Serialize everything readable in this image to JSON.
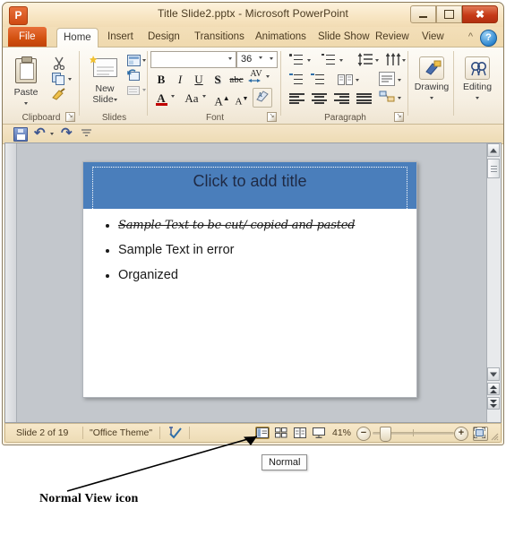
{
  "window": {
    "title": "Title Slide2.pptx  -  Microsoft PowerPoint",
    "app_logo": "P",
    "minimize_label": "Minimize",
    "maximize_label": "Restore",
    "close_label": "Close"
  },
  "tabs": [
    {
      "label": "File",
      "active": false,
      "type": "file"
    },
    {
      "label": "Home",
      "active": true
    },
    {
      "label": "Insert",
      "active": false
    },
    {
      "label": "Design",
      "active": false
    },
    {
      "label": "Transitions",
      "active": false
    },
    {
      "label": "Animations",
      "active": false
    },
    {
      "label": "Slide Show",
      "active": false
    },
    {
      "label": "Review",
      "active": false
    },
    {
      "label": "View",
      "active": false
    }
  ],
  "ribbon": {
    "collapse_label": "^",
    "help_label": "?",
    "groups": [
      {
        "name": "Clipboard",
        "label": "Clipboard"
      },
      {
        "name": "Slides",
        "label": "Slides"
      },
      {
        "name": "Font",
        "label": "Font"
      },
      {
        "name": "Paragraph",
        "label": "Paragraph"
      },
      {
        "name": "Drawing",
        "label": "Drawing"
      },
      {
        "name": "Editing",
        "label": "Editing"
      }
    ],
    "clipboard": {
      "paste_label": "Paste",
      "cut_label": "Cut",
      "copy_label": "Copy",
      "format_painter_label": "Format Painter",
      "dialog_launcher": "↘"
    },
    "slides": {
      "new_slide_line1": "New",
      "new_slide_line2": "Slide",
      "layout_label": "Layout",
      "reset_label": "Reset",
      "section_label": "Section"
    },
    "font": {
      "font_name_value": "",
      "font_size_value": "36",
      "bold_label": "B",
      "italic_label": "I",
      "underline_label": "U",
      "shadow_label": "S",
      "strikethrough_label": "abc",
      "character_spacing_label": "AV",
      "font_color_label": "A",
      "change_case_label": "Aa",
      "grow_font_label": "A",
      "shrink_font_label": "A",
      "clear_formatting_label": "A",
      "dialog_launcher": "↘"
    },
    "paragraph": {
      "bullets_label": "Bullets",
      "numbering_label": "Numbering",
      "line_spacing_label": "Line Spacing",
      "text_direction_label": "Text Direction",
      "decrease_indent_label": "Decrease Indent",
      "increase_indent_label": "Increase Indent",
      "columns_label": "Columns",
      "align_text_label": "Align Text",
      "smartart_label": "Convert to SmartArt",
      "align_left_label": "Align Left",
      "center_label": "Center",
      "align_right_label": "Align Right",
      "justify_label": "Justify",
      "dialog_launcher": "↘"
    },
    "drawing": {
      "label": "Drawing"
    },
    "editing": {
      "label": "Editing"
    }
  },
  "quick_access": {
    "save_label": "Save",
    "undo_label": "Undo",
    "redo_label": "Redo",
    "customize_label": "Customize Quick Access Toolbar"
  },
  "slide": {
    "title_placeholder": "Click to add title",
    "title_banner_color": "#4a7ebb",
    "bullets": [
      {
        "text": "Sample Text to be cut/ copied and pasted",
        "style": "script-strikethrough"
      },
      {
        "text": "Sample Text in error",
        "style": "normal"
      },
      {
        "text": "Organized",
        "style": "normal"
      }
    ]
  },
  "scrollbar": {
    "up_label": "Scroll Up",
    "down_label": "Scroll Down",
    "previous_slide_label": "Previous Slide",
    "next_slide_label": "Next Slide"
  },
  "status_bar": {
    "slide_indicator": "Slide 2 of 19",
    "theme_name": "\"Office Theme\"",
    "spell_check_label": "Spelling Check",
    "views": [
      {
        "name": "normal",
        "label": "Normal",
        "selected": true
      },
      {
        "name": "slide-sorter",
        "label": "Slide Sorter",
        "selected": false
      },
      {
        "name": "reading",
        "label": "Reading View",
        "selected": false
      },
      {
        "name": "slide-show",
        "label": "Slide Show",
        "selected": false
      }
    ],
    "zoom_value": "41%",
    "zoom_out_label": "−",
    "zoom_in_label": "+",
    "fit_to_window_label": "Fit slide to current window"
  },
  "tooltip": {
    "text": "Normal"
  },
  "annotation": {
    "text": "Normal View icon"
  }
}
